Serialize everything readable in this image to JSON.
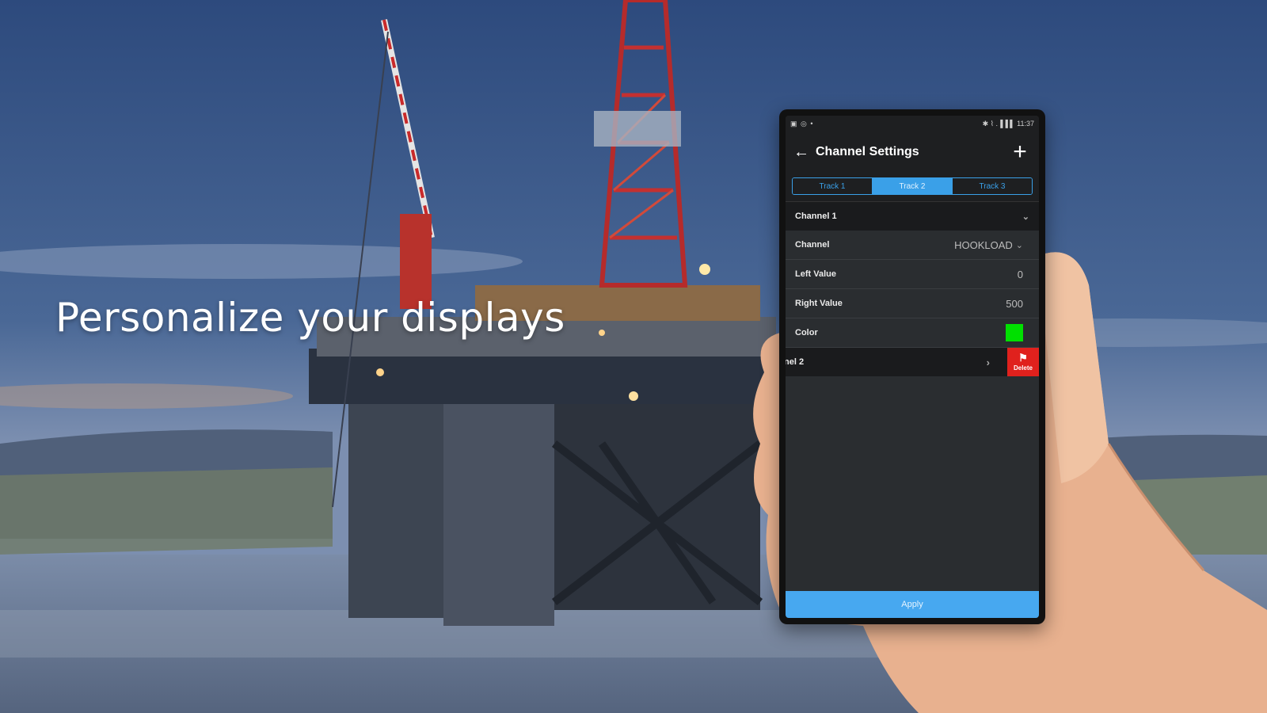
{
  "headline": "Personalize your displays",
  "status_bar": {
    "left_icons": "▣ ◎ •",
    "right_text": "✱ ⌇ .▐▐ ▌ 11:37"
  },
  "app_bar": {
    "title": "Channel Settings",
    "back_icon": "←",
    "add_icon": "+"
  },
  "tabs": [
    {
      "label": "Track 1"
    },
    {
      "label": "Track 2"
    },
    {
      "label": "Track 3"
    }
  ],
  "active_tab_index": 1,
  "group": {
    "label": "Channel 1",
    "chevron": "⌄"
  },
  "rows": [
    {
      "label": "Channel",
      "value": "HOOKLOAD",
      "chevron": "⌄"
    },
    {
      "label": "Left Value",
      "value": "0"
    },
    {
      "label": "Right Value",
      "value": "500"
    },
    {
      "label": "Color",
      "color": "#00e000"
    }
  ],
  "swiped_row": {
    "label": "nel 2",
    "arrow": "›",
    "delete_label": "Delete",
    "delete_icon": "⚑"
  },
  "apply_label": "Apply",
  "colors": {
    "accent": "#3aa0e8",
    "apply": "#47a8f0",
    "delete": "#e0211d",
    "swatch": "#00e000"
  }
}
